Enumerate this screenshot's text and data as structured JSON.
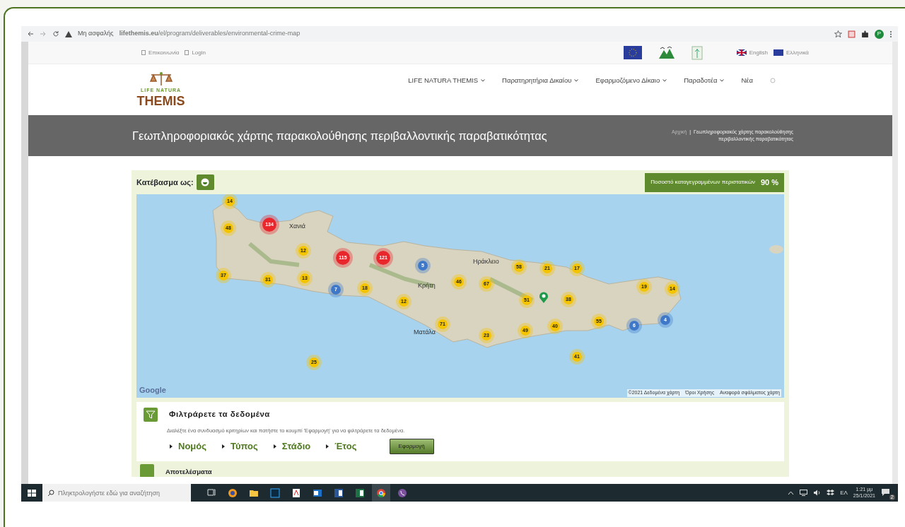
{
  "browser": {
    "security_label": "Μη ασφαλής",
    "url": "**lifethemis.eu**/el/program/deliverables/environmental-crime-map",
    "profile_initial": "P"
  },
  "top_bar": {
    "links": [
      {
        "label": "Επικοινωνία"
      },
      {
        "label": "Login"
      }
    ],
    "languages": [
      {
        "label": "English",
        "kind": "uk"
      },
      {
        "label": "Ελληνικά",
        "kind": "eu"
      }
    ]
  },
  "header": {
    "logo": {
      "small": "LIFE NATURA",
      "big": "THEMIS"
    },
    "menu": [
      {
        "label": "LIFE NATURA THEMIS",
        "dropdown": true
      },
      {
        "label": "Παρατηρητήρια Δικαίου",
        "dropdown": true
      },
      {
        "label": "Εφαρμοζόμενο Δίκαιο",
        "dropdown": true
      },
      {
        "label": "Παραδοτέα",
        "dropdown": true
      },
      {
        "label": "Νέα",
        "dropdown": false
      }
    ]
  },
  "banner": {
    "separator": "|",
    "title": "Γεωπληροφοριακός χάρτης παρακολούθησης περιβαλλοντικής παραβατικότητας",
    "breadcrumb": [
      "Αρχική",
      "Γεωπληροφοριακός χάρτης παρακολούθησης περιβαλλοντικής παραβατικότητας"
    ]
  },
  "map_panel": {
    "download_label": "Κατέβασμα ως:",
    "stat_label": "Ποσοστό καταγεγραμμένων περιστατικών",
    "stat_value": "90 %",
    "places": [
      {
        "label": "Χανιά"
      },
      {
        "label": "Κρήτη"
      },
      {
        "label": "Ηράκλειο"
      },
      {
        "label": "Ματάλα"
      }
    ],
    "markers": [
      {
        "label": "14",
        "color": "#f5c400"
      },
      {
        "label": "48",
        "color": "#f5c400"
      },
      {
        "label": "134",
        "color": "#e8262b"
      },
      {
        "label": "12",
        "color": "#f5c400"
      },
      {
        "label": "115",
        "color": "#e8262b"
      },
      {
        "label": "121",
        "color": "#e8262b"
      },
      {
        "label": "5",
        "color": "#3f78c8"
      },
      {
        "label": "37",
        "color": "#f5c400"
      },
      {
        "label": "31",
        "color": "#f5c400"
      },
      {
        "label": "13",
        "color": "#f5c400"
      },
      {
        "label": "7",
        "color": "#3f78c8"
      },
      {
        "label": "18",
        "color": "#f5c400"
      },
      {
        "label": "46",
        "color": "#f5c400"
      },
      {
        "label": "67",
        "color": "#f5c400"
      },
      {
        "label": "58",
        "color": "#f5c400"
      },
      {
        "label": "21",
        "color": "#f5c400"
      },
      {
        "label": "17",
        "color": "#f5c400"
      },
      {
        "label": "12",
        "color": "#f5c400"
      },
      {
        "label": "51",
        "color": "#f5c400"
      },
      {
        "label": "38",
        "color": "#f5c400"
      },
      {
        "label": "19",
        "color": "#f5c400"
      },
      {
        "label": "14",
        "color": "#f5c400"
      },
      {
        "label": "71",
        "color": "#f5c400"
      },
      {
        "label": "49",
        "color": "#f5c400"
      },
      {
        "label": "40",
        "color": "#f5c400"
      },
      {
        "label": "55",
        "color": "#f5c400"
      },
      {
        "label": "6",
        "color": "#3f78c8"
      },
      {
        "label": "4",
        "color": "#3f78c8"
      },
      {
        "label": "23",
        "color": "#f5c400"
      },
      {
        "label": "41",
        "color": "#f5c400"
      },
      {
        "label": "25",
        "color": "#f5c400"
      }
    ],
    "google": "Google",
    "footer": [
      "©2021 Δεδομένα χάρτη",
      "Όροι Χρήσης",
      "Αναφορά σφάλματος χάρτη"
    ]
  },
  "filter": {
    "title": "Φιλτράρετε τα δεδομένα",
    "description": "Διαλέξτε ένα συνδυασμό κριτηρίων και πατήστε το κουμπί 'Εφαρμογή' για να φιλτράρετε τα δεδομένα.",
    "filters": [
      {
        "label": "Νομός"
      },
      {
        "label": "Τύπος"
      },
      {
        "label": "Στάδιο"
      },
      {
        "label": "Έτος"
      }
    ],
    "apply": "Εφαρμογή"
  },
  "results": {
    "title": "Αποτελέσματα"
  },
  "taskbar": {
    "search_placeholder": "Πληκτρολογήστε εδώ για αναζήτηση",
    "apps": [
      {
        "kind": "taskview",
        "selected": false
      },
      {
        "kind": "browser",
        "selected": false
      },
      {
        "kind": "folder",
        "selected": false
      },
      {
        "kind": "photo",
        "selected": false
      },
      {
        "kind": "pdf",
        "selected": false
      },
      {
        "kind": "mail",
        "selected": false
      },
      {
        "kind": "word",
        "selected": false
      },
      {
        "kind": "sheet",
        "selected": false
      },
      {
        "kind": "chrome",
        "selected": true
      },
      {
        "kind": "phone",
        "selected": false
      }
    ],
    "language": "ΕΛ",
    "time": "1:21 μμ",
    "date": "25/1/2021",
    "notifications": "2"
  }
}
